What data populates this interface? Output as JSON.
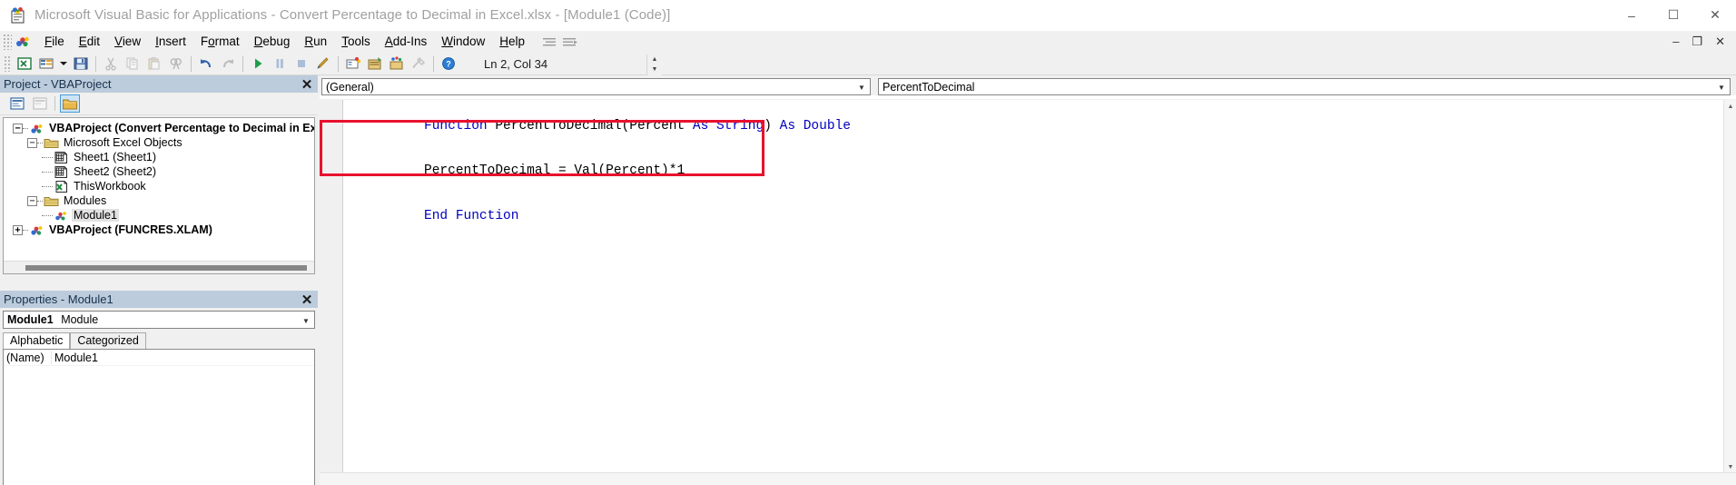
{
  "window": {
    "title": "Microsoft Visual Basic for Applications - Convert Percentage to Decimal in Excel.xlsx - [Module1 (Code)]",
    "app_icon": "vba-app-icon",
    "minimize": "–",
    "maximize": "☐",
    "close": "✕"
  },
  "menubar": {
    "items": [
      {
        "label": "File",
        "accel": "F"
      },
      {
        "label": "Edit",
        "accel": "E"
      },
      {
        "label": "View",
        "accel": "V"
      },
      {
        "label": "Insert",
        "accel": "I"
      },
      {
        "label": "Format",
        "accel": "o"
      },
      {
        "label": "Debug",
        "accel": "D"
      },
      {
        "label": "Run",
        "accel": "R"
      },
      {
        "label": "Tools",
        "accel": "T"
      },
      {
        "label": "Add-Ins",
        "accel": "A"
      },
      {
        "label": "Window",
        "accel": "W"
      },
      {
        "label": "Help",
        "accel": "H"
      }
    ],
    "doc_minimize": "–",
    "doc_restore": "❐",
    "doc_close": "✕"
  },
  "toolbar": {
    "buttons": [
      {
        "name": "view-excel-icon",
        "label": "View Microsoft Excel"
      },
      {
        "name": "insert-userform-icon",
        "label": "Insert"
      },
      {
        "name": "insert-dropdown-icon",
        "label": "Insert menu"
      },
      {
        "name": "save-icon",
        "label": "Save"
      },
      {
        "name": "cut-icon",
        "label": "Cut"
      },
      {
        "name": "copy-icon",
        "label": "Copy"
      },
      {
        "name": "paste-icon",
        "label": "Paste"
      },
      {
        "name": "find-icon",
        "label": "Find"
      },
      {
        "name": "undo-icon",
        "label": "Undo"
      },
      {
        "name": "redo-icon",
        "label": "Redo"
      },
      {
        "name": "run-icon",
        "label": "Run Sub/UserForm"
      },
      {
        "name": "break-icon",
        "label": "Break"
      },
      {
        "name": "reset-icon",
        "label": "Reset"
      },
      {
        "name": "design-mode-icon",
        "label": "Design Mode"
      },
      {
        "name": "project-explorer-icon",
        "label": "Project Explorer"
      },
      {
        "name": "properties-window-icon",
        "label": "Properties Window"
      },
      {
        "name": "object-browser-icon",
        "label": "Object Browser"
      },
      {
        "name": "toolbox-icon",
        "label": "Toolbox"
      },
      {
        "name": "help-icon",
        "label": "Help"
      }
    ],
    "position_indicator": "Ln 2, Col 34"
  },
  "project_explorer": {
    "panel_title": "Project - VBAProject",
    "close_label": "✕",
    "toolbar_buttons": [
      {
        "name": "view-code-icon",
        "label": "View Code"
      },
      {
        "name": "view-object-icon",
        "label": "View Object"
      },
      {
        "name": "toggle-folders-icon",
        "label": "Toggle Folders",
        "active": true
      }
    ],
    "tree": [
      {
        "label": "VBAProject (Convert Percentage to Decimal in Excel.x...)",
        "level": 0,
        "expander": "−",
        "icon": "vbaproject-icon",
        "bold": true,
        "selected": false
      },
      {
        "label": "Microsoft Excel Objects",
        "level": 1,
        "expander": "−",
        "icon": "folder-icon",
        "bold": false,
        "selected": false
      },
      {
        "label": "Sheet1 (Sheet1)",
        "level": 2,
        "expander": "",
        "icon": "worksheet-icon",
        "bold": false,
        "selected": false
      },
      {
        "label": "Sheet2 (Sheet2)",
        "level": 2,
        "expander": "",
        "icon": "worksheet-icon",
        "bold": false,
        "selected": false
      },
      {
        "label": "ThisWorkbook",
        "level": 2,
        "expander": "",
        "icon": "workbook-icon",
        "bold": false,
        "selected": false
      },
      {
        "label": "Modules",
        "level": 1,
        "expander": "−",
        "icon": "folder-icon",
        "bold": false,
        "selected": false
      },
      {
        "label": "Module1",
        "level": 2,
        "expander": "",
        "icon": "module-icon",
        "bold": false,
        "selected": true
      },
      {
        "label": "VBAProject (FUNCRES.XLAM)",
        "level": 0,
        "expander": "+",
        "icon": "vbaproject-icon",
        "bold": true,
        "selected": false
      }
    ]
  },
  "properties": {
    "panel_title": "Properties - Module1",
    "close_label": "✕",
    "object_combo": {
      "name": "Module1",
      "type": "Module",
      "arrow": "▼"
    },
    "tabs": [
      {
        "label": "Alphabetic",
        "active": true
      },
      {
        "label": "Categorized",
        "active": false
      }
    ],
    "rows": [
      {
        "key": "(Name)",
        "value": "Module1"
      }
    ]
  },
  "code_window": {
    "object_combo": {
      "value": "(General)",
      "arrow": "▼"
    },
    "proc_combo": {
      "value": "PercentToDecimal",
      "arrow": "▼"
    },
    "annotation_color": "#e8112d",
    "keyword_color": "#0000c0",
    "lines": [
      [
        {
          "t": "Function",
          "kw": true
        },
        {
          "t": " PercentToDecimal(Percent ",
          "kw": false
        },
        {
          "t": "As String",
          "kw": true
        },
        {
          "t": ") ",
          "kw": false
        },
        {
          "t": "As Double",
          "kw": true
        }
      ],
      [
        {
          "t": "PercentToDecimal = Val(Percent)*1",
          "kw": false
        }
      ],
      [
        {
          "t": "End Function",
          "kw": true
        }
      ]
    ],
    "scroll_up": "▲",
    "scroll_down": "▼",
    "scroll_left": "◄",
    "scroll_right": "►"
  }
}
